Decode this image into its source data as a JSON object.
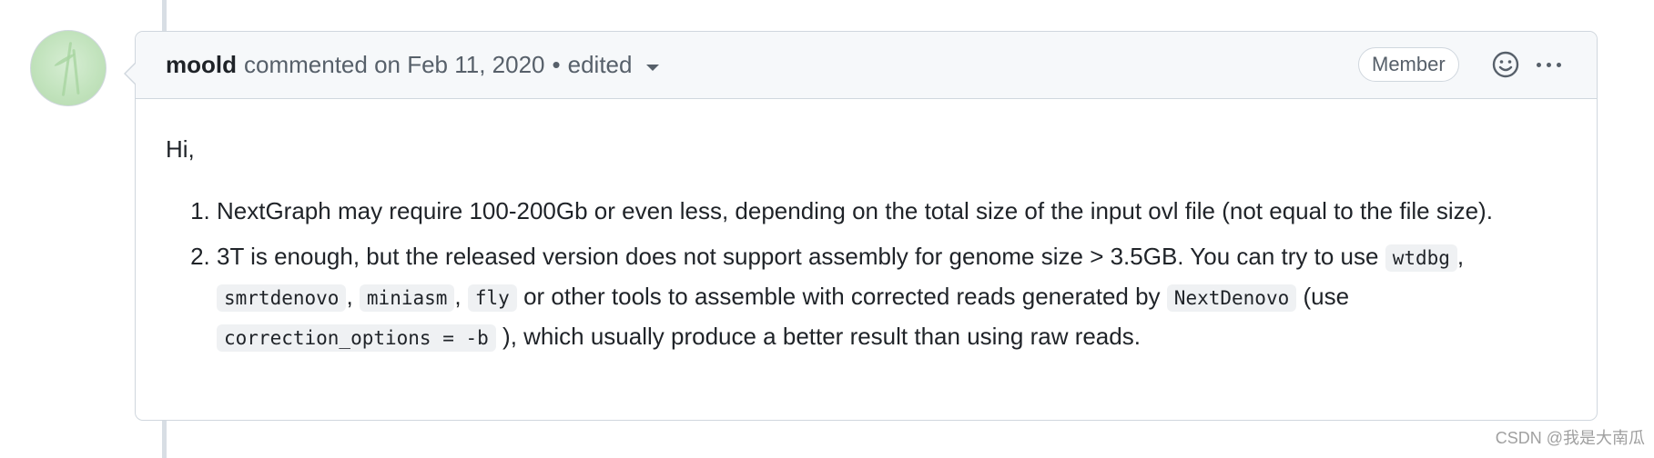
{
  "comment": {
    "author": "moold",
    "meta": "commented on Feb 11, 2020",
    "separator": "•",
    "edited": "edited",
    "badge": "Member",
    "greeting": "Hi,",
    "items": [
      {
        "text": "NextGraph may require 100-200Gb or even less, depending on the total size of the input ovl file (not equal to the file size)."
      },
      {
        "t1": "3T is enough, but the released version does not support assembly for genome size > 3.5GB. You can try to use",
        "c1": "wtdbg",
        "t2": ",",
        "c2": "smrtdenovo",
        "t3": ",",
        "c3": "miniasm",
        "t4": ",",
        "c4": "fly",
        "t5": "or other tools to assemble with corrected reads generated by",
        "c5": "NextDenovo",
        "t6": "(use",
        "c6": "correction_options = -b",
        "t7": "), which usually produce a better result than using raw reads."
      }
    ]
  },
  "icons": {
    "emoji": "smiley-icon",
    "more": "kebab-horizontal-icon",
    "caret": "triangle-down-icon"
  },
  "watermark": "CSDN @我是大南瓜",
  "colors": {
    "header_bg": "#f6f8fa",
    "border": "#d0d7de",
    "text": "#1f2328",
    "muted": "#57606a",
    "code_bg": "#eff1f3"
  }
}
